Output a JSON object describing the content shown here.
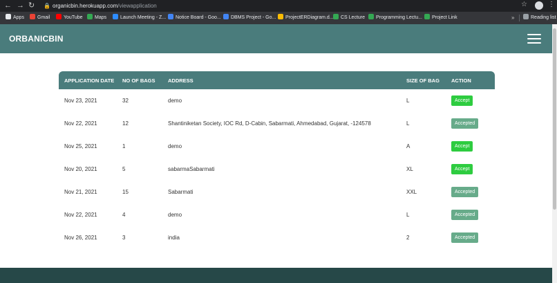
{
  "browser": {
    "url_host": "organicbin.herokuapp.com",
    "url_path": "/viewapplication",
    "bookmarks": [
      {
        "label": "Apps",
        "icon": "apps-grid-icon",
        "color": "#e8eaed"
      },
      {
        "label": "Gmail",
        "icon": "gmail-icon",
        "color": "#ea4335"
      },
      {
        "label": "YouTube",
        "icon": "youtube-icon",
        "color": "#ff0000"
      },
      {
        "label": "Maps",
        "icon": "maps-icon",
        "color": "#34a853"
      },
      {
        "label": "Launch Meeting - Z...",
        "icon": "zoom-icon",
        "color": "#2d8cff"
      },
      {
        "label": "Notice Board - Goo...",
        "icon": "docs-icon",
        "color": "#4285f4"
      },
      {
        "label": "DBMS Project - Go...",
        "icon": "docs-icon",
        "color": "#4285f4"
      },
      {
        "label": "ProjectERDiagram.d...",
        "icon": "drive-icon",
        "color": "#fbbc04"
      },
      {
        "label": "CS Lecture",
        "icon": "chrome-icon",
        "color": "#34a853"
      },
      {
        "label": "Programming Lectu...",
        "icon": "chrome-icon",
        "color": "#34a853"
      },
      {
        "label": "Project Link",
        "icon": "chrome-icon",
        "color": "#34a853"
      }
    ],
    "overflow": "»",
    "reading_list": "Reading list"
  },
  "header": {
    "brand": "ORBANICBIN"
  },
  "table": {
    "columns": [
      "APPLICATION DATE",
      "NO OF BAGS",
      "ADDRESS",
      "SIZE OF BAG",
      "ACTION"
    ],
    "rows": [
      {
        "date": "Nov 23, 2021",
        "bags": "32",
        "address": "demo",
        "size": "L",
        "action": "Accept",
        "status": "accept"
      },
      {
        "date": "Nov 22, 2021",
        "bags": "12",
        "address": "Shantiniketan Society, IOC Rd, D-Cabin, Sabarmati, Ahmedabad, Gujarat, -124578",
        "size": "L",
        "action": "Accepted",
        "status": "accepted"
      },
      {
        "date": "Nov 25, 2021",
        "bags": "1",
        "address": "demo",
        "size": "A",
        "action": "Accept",
        "status": "accept"
      },
      {
        "date": "Nov 20, 2021",
        "bags": "5",
        "address": "sabarmaSabarmati",
        "size": "XL",
        "action": "Accept",
        "status": "accept"
      },
      {
        "date": "Nov 21, 2021",
        "bags": "15",
        "address": "Sabarmati",
        "size": "XXL",
        "action": "Accepted",
        "status": "accepted"
      },
      {
        "date": "Nov 22, 2021",
        "bags": "4",
        "address": "demo",
        "size": "L",
        "action": "Accepted",
        "status": "accepted"
      },
      {
        "date": "Nov 26, 2021",
        "bags": "3",
        "address": "india",
        "size": "2",
        "action": "Accepted",
        "status": "accepted"
      }
    ]
  },
  "colors": {
    "header_bg": "#4a7c7c",
    "accept_button": "#2ecc40",
    "accepted_button": "#67ab8a",
    "footer_bg": "#264848"
  }
}
